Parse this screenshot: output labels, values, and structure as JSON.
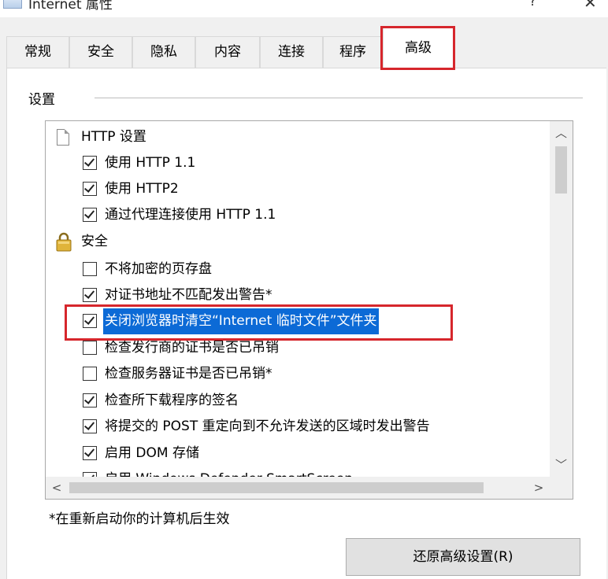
{
  "window": {
    "title": "Internet 属性",
    "help_glyph": "?",
    "close_glyph": "✕"
  },
  "tabs": [
    {
      "label": "常规",
      "active": false
    },
    {
      "label": "安全",
      "active": false
    },
    {
      "label": "隐私",
      "active": false
    },
    {
      "label": "内容",
      "active": false
    },
    {
      "label": "连接",
      "active": false
    },
    {
      "label": "程序",
      "active": false
    },
    {
      "label": "高级",
      "active": true
    }
  ],
  "settings": {
    "group_label": "设置",
    "categories": [
      {
        "label": "HTTP 设置",
        "icon": "page-icon",
        "items": [
          {
            "label": "使用 HTTP 1.1",
            "checked": true
          },
          {
            "label": "使用 HTTP2",
            "checked": true
          },
          {
            "label": "通过代理连接使用 HTTP 1.1",
            "checked": true
          }
        ]
      },
      {
        "label": "安全",
        "icon": "lock-icon",
        "items": [
          {
            "label": "不将加密的页存盘",
            "checked": false
          },
          {
            "label": "对证书地址不匹配发出警告*",
            "checked": true
          },
          {
            "label": "关闭浏览器时清空“Internet 临时文件”文件夹",
            "checked": true,
            "selected": true
          },
          {
            "label": "检查发行商的证书是否已吊销",
            "checked": false
          },
          {
            "label": "检查服务器证书是否已吊销*",
            "checked": false
          },
          {
            "label": "检查所下载程序的签名",
            "checked": true
          },
          {
            "label": "将提交的 POST 重定向到不允许发送的区域时发出警告",
            "checked": true
          },
          {
            "label": "启用 DOM 存储",
            "checked": true
          },
          {
            "label": "启用 Windows Defender SmartScreen",
            "checked": true
          }
        ]
      }
    ]
  },
  "footnote": "*在重新启动你的计算机后生效",
  "restore_button": "还原高级设置(R)",
  "colors": {
    "highlight_border": "#d6262c",
    "selection": "#0c6ad6"
  }
}
